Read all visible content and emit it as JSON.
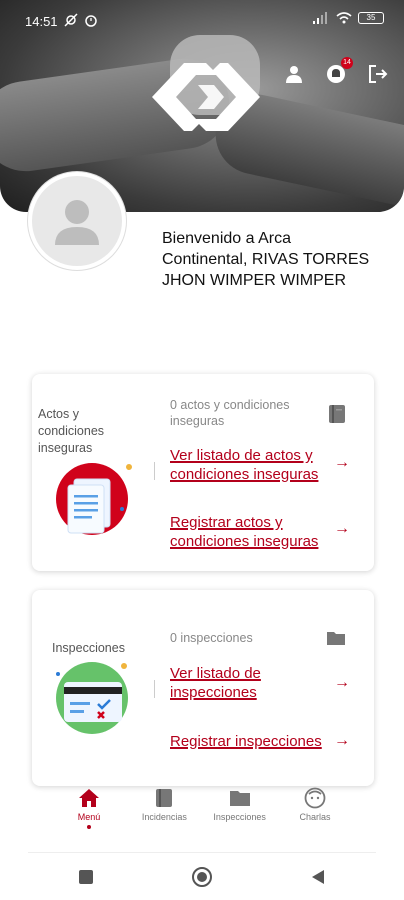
{
  "status_bar": {
    "time": "14:51",
    "battery": "35"
  },
  "header": {
    "notification_count": "14"
  },
  "welcome": {
    "text": "Bienvenido a Arca Continental, RIVAS TORRES JHON WIMPER WIMPER"
  },
  "cards": [
    {
      "title": "Actos y condiciones inseguras",
      "count": "0 actos y condiciones inseguras",
      "link_list": "Ver listado de actos y condiciones inseguras",
      "link_register": "Registrar actos y condiciones inseguras",
      "count_icon": "book-icon",
      "illustration": "document-icon"
    },
    {
      "title": "Inspecciones",
      "count": "0 inspecciones",
      "link_list": "Ver listado de inspecciones",
      "link_register": "Registrar inspecciones",
      "count_icon": "folder-icon",
      "illustration": "checklist-card-icon"
    }
  ],
  "bottom_nav": [
    {
      "label": "Menú",
      "icon": "home-icon",
      "active": true
    },
    {
      "label": "Incidencias",
      "icon": "book-icon",
      "active": false
    },
    {
      "label": "Inspecciones",
      "icon": "folder-icon",
      "active": false
    },
    {
      "label": "Charlas",
      "icon": "face-icon",
      "active": false
    }
  ],
  "colors": {
    "accent": "#b3001b",
    "card_bg": "#ffffff"
  }
}
